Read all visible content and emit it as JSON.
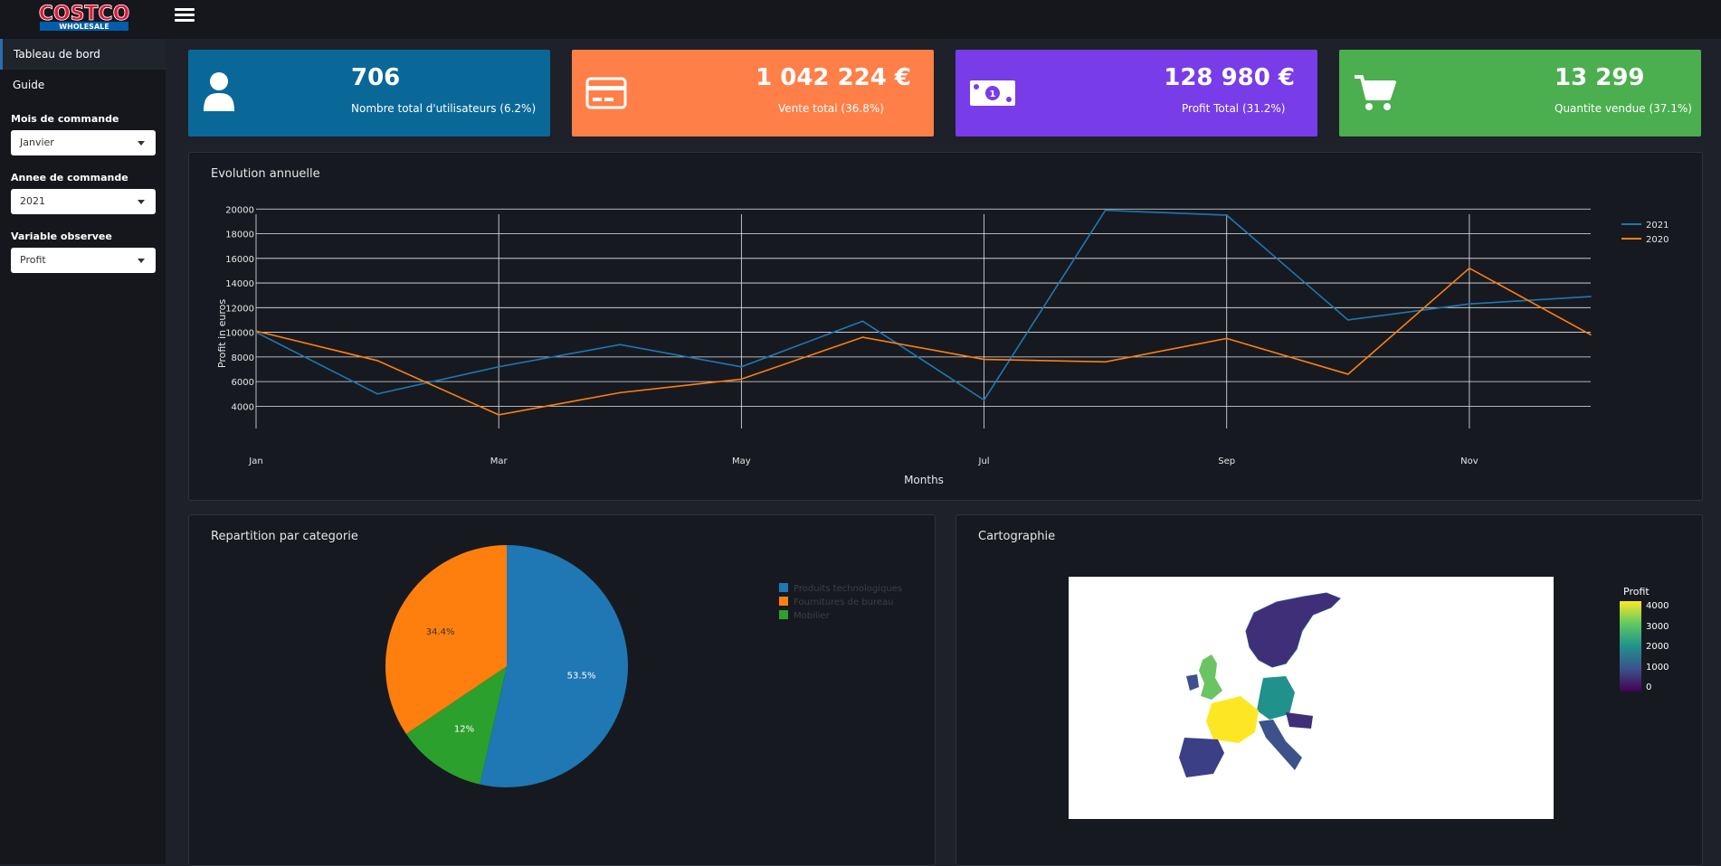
{
  "header": {
    "logo_top": "COSTCO",
    "logo_bottom": "WHOLESALE"
  },
  "sidebar": {
    "items": [
      {
        "label": "Tableau de bord",
        "active": true
      },
      {
        "label": "Guide",
        "active": false
      }
    ],
    "filters": [
      {
        "label": "Mois de commande",
        "value": "Janvier"
      },
      {
        "label": "Annee de commande",
        "value": "2021"
      },
      {
        "label": "Variable observee",
        "value": "Profit"
      }
    ]
  },
  "kpis": [
    {
      "value": "706",
      "label": "Nombre total d'utilisateurs (6.2%)",
      "color": "#0a6898",
      "icon": "user-icon"
    },
    {
      "value": "1 042 224 €",
      "label": "Vente total (36.8%)",
      "color": "#ff7f48",
      "icon": "credit-card-icon"
    },
    {
      "value": "128 980 €",
      "label": "Profit Total (31.2%)",
      "color": "#783ce8",
      "icon": "money-bill-icon"
    },
    {
      "value": "13 299",
      "label": "Quantite vendue (37.1%)",
      "color": "#4bae4f",
      "icon": "shopping-cart-icon"
    }
  ],
  "line_panel": {
    "title": "Evolution annuelle"
  },
  "pie_panel": {
    "title": "Repartition par categorie"
  },
  "map_panel": {
    "title": "Cartographie",
    "colorbar_title": "Profit",
    "colorbar_ticks": [
      "4000",
      "3000",
      "2000",
      "1000",
      "0"
    ]
  },
  "chart_data": [
    {
      "type": "line",
      "title": "",
      "xlabel": "Months",
      "ylabel": "Profit in euros",
      "x_tick_labels": [
        "Jan",
        "Mar",
        "May",
        "Jul",
        "Sep",
        "Nov"
      ],
      "y_ticks": [
        4000,
        6000,
        8000,
        10000,
        12000,
        14000,
        16000,
        18000,
        20000
      ],
      "ylim": [
        3000,
        20900
      ],
      "months": [
        "Jan",
        "Feb",
        "Mar",
        "Apr",
        "May",
        "Jun",
        "Jul",
        "Aug",
        "Sep",
        "Oct",
        "Nov",
        "Dec"
      ],
      "series": [
        {
          "name": "2021",
          "color": "#1f77b4",
          "values": [
            10000,
            5000,
            7200,
            9000,
            7200,
            10900,
            4500,
            19900,
            19500,
            11000,
            12300,
            12900
          ]
        },
        {
          "name": "2020",
          "color": "#ff7f0e",
          "values": [
            10100,
            7700,
            3300,
            5100,
            6200,
            9600,
            7800,
            7600,
            9500,
            6600,
            15200,
            9800
          ]
        }
      ],
      "grid": true,
      "legend": "top-right"
    },
    {
      "type": "pie",
      "title": "",
      "labels": [
        "Produits technologiques",
        "Fournitures de bureau",
        "Mobilier"
      ],
      "values": [
        53.5,
        34.4,
        12
      ],
      "value_labels": [
        "53.5%",
        "34.4%",
        "12%"
      ],
      "colors": [
        "#1f77b4",
        "#ff7f0e",
        "#2ca02c"
      ],
      "legend": "top-right"
    }
  ]
}
